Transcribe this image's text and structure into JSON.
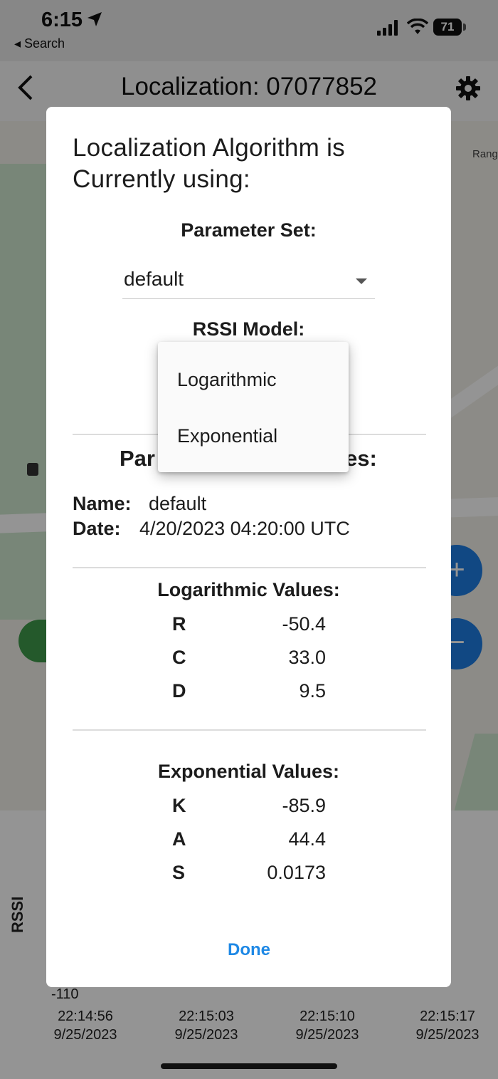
{
  "status_bar": {
    "time": "6:15",
    "back_app": "◂ Search",
    "battery": "71"
  },
  "header": {
    "title": "Localization: 07077852"
  },
  "map": {
    "partial_label": "Rang"
  },
  "chart": {
    "y_axis_label": "RSSI",
    "y_tick": "-110",
    "x_ticks": [
      {
        "time": "22:14:56",
        "date": "9/25/2023"
      },
      {
        "time": "22:15:03",
        "date": "9/25/2023"
      },
      {
        "time": "22:15:10",
        "date": "9/25/2023"
      },
      {
        "time": "22:15:17",
        "date": "9/25/2023"
      }
    ]
  },
  "dialog": {
    "title": "Localization Algorithm is Currently using:",
    "parameter_set_heading": "Parameter Set:",
    "parameter_set_value": "default",
    "rssi_model_heading": "RSSI Model:",
    "parameter_values_heading_left": "Par",
    "parameter_values_heading_right": "es:",
    "name_label": "Name:",
    "name_value": "default",
    "date_label": "Date:",
    "date_value": "4/20/2023 04:20:00 UTC",
    "log_heading": "Logarithmic Values:",
    "log_values": [
      {
        "key": "R",
        "value": "-50.4"
      },
      {
        "key": "C",
        "value": "33.0"
      },
      {
        "key": "D",
        "value": "9.5"
      }
    ],
    "exp_heading": "Exponential Values:",
    "exp_values": [
      {
        "key": "K",
        "value": "-85.9"
      },
      {
        "key": "A",
        "value": "44.4"
      },
      {
        "key": "S",
        "value": "0.0173"
      }
    ],
    "done_label": "Done"
  },
  "dropdown_menu": {
    "options": [
      "Logarithmic",
      "Exponential"
    ]
  }
}
